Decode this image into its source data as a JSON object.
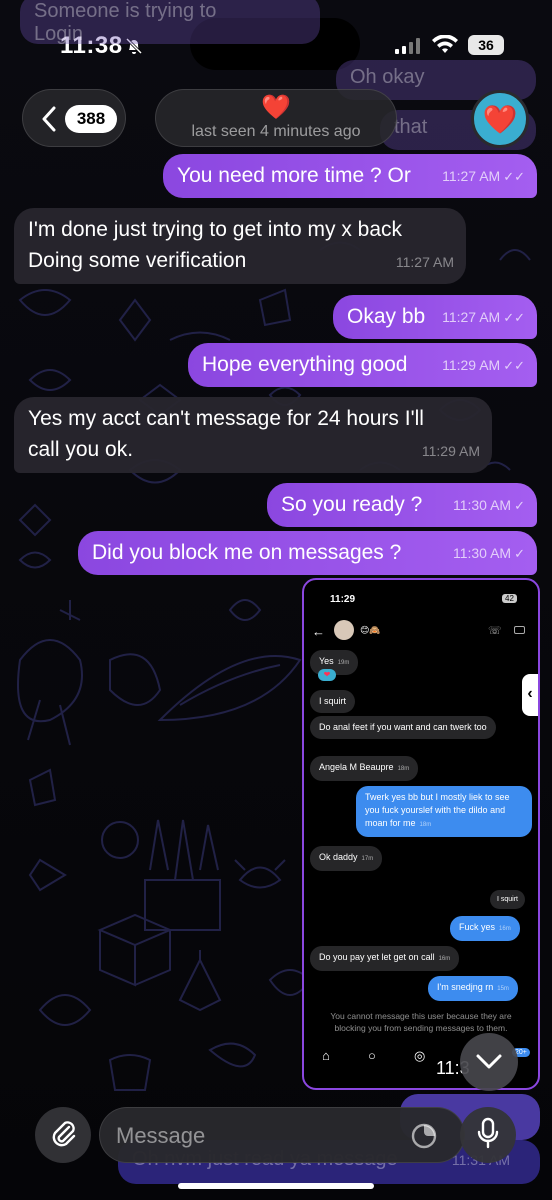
{
  "status_bar": {
    "time": "11:38",
    "battery": "36"
  },
  "ghost_top": {
    "text1": "Someone is trying to",
    "text2": "Login",
    "text3": "Oh okay",
    "text4": "that"
  },
  "header": {
    "back_count": "388",
    "title_emoji": "❤️",
    "last_seen": "last seen 4 minutes ago",
    "avatar_emoji": "❤️"
  },
  "messages": [
    {
      "dir": "out",
      "text": "You need more time ? Or",
      "time": "11:27 AM",
      "ticks": "✓✓"
    },
    {
      "dir": "in",
      "lines": [
        "I'm done just trying to get into my x back",
        "Doing some verification"
      ],
      "time": "11:27 AM"
    },
    {
      "dir": "out",
      "text": "Okay bb",
      "time": "11:27 AM",
      "ticks": "✓✓"
    },
    {
      "dir": "out",
      "text": "Hope everything good",
      "time": "11:29 AM",
      "ticks": "✓✓"
    },
    {
      "dir": "in",
      "lines": [
        "Yes my acct can't message for 24 hours I'll",
        "call you ok."
      ],
      "time": "11:29 AM"
    },
    {
      "dir": "out",
      "text": "So you ready ?",
      "time": "11:30 AM",
      "ticks": "✓"
    },
    {
      "dir": "out",
      "text": "Did you block me on messages ?",
      "time": "11:30 AM",
      "ticks": "✓"
    }
  ],
  "screenshot": {
    "time": "11:29",
    "battery": "42",
    "header_emojis": "😊🙈",
    "items": [
      {
        "text": "Yes",
        "sub": "19m",
        "blue": false
      },
      {
        "text": "I squirt",
        "sub": "",
        "blue": false
      },
      {
        "text": "Do anal feet if you want and can twerk too",
        "sub": "",
        "blue": false
      },
      {
        "text": "Angela M Beaupre",
        "sub": "18m",
        "blue": false
      },
      {
        "text": "Twerk yes bb but I mostly liek to see you fuck yourslef with the dildo and moan for me",
        "sub": "18m",
        "blue": true
      },
      {
        "text": "Ok daddy",
        "sub": "17m",
        "blue": false
      },
      {
        "text": "I squirt",
        "sub": "",
        "blue": false
      },
      {
        "text": "Fuck yes",
        "sub": "16m",
        "blue": true
      },
      {
        "text": "Do you pay yet let get on call",
        "sub": "16m",
        "blue": false
      },
      {
        "text": "I'm snedjng rn",
        "sub": "15m",
        "blue": true
      }
    ],
    "blocked_notice": "You cannot message this user because they are blocking you from sending messages to them.",
    "badge": "20+"
  },
  "scroll": {
    "time_peek": "11:3"
  },
  "ghost_bottom": {
    "text": "Oh nvm just read ya message",
    "time": "11:31 AM"
  },
  "composer": {
    "placeholder": "Message"
  },
  "colors": {
    "outgoing": "#9a52ea",
    "incoming": "#28262e",
    "accent": "#8b47e0"
  }
}
